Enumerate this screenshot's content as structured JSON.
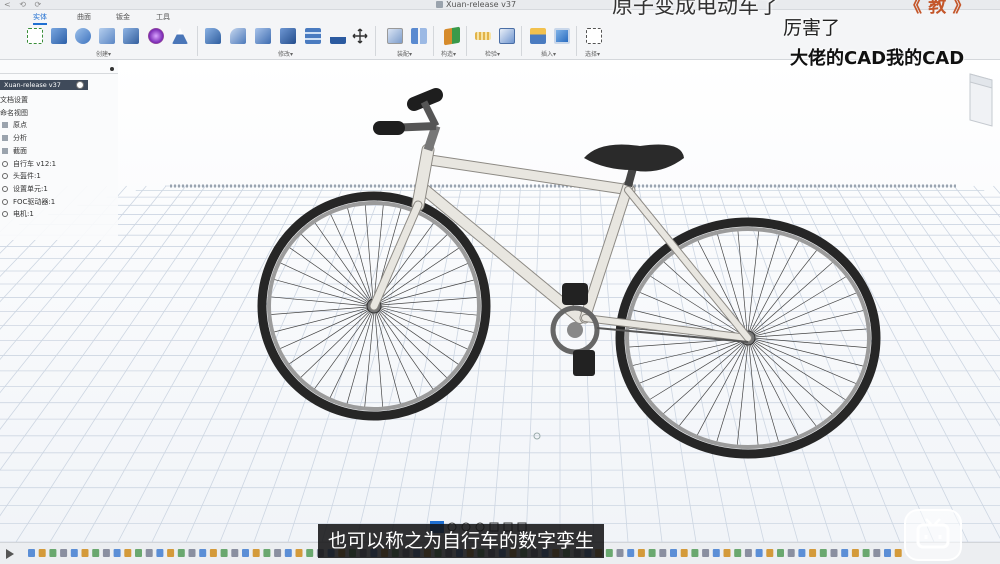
{
  "window": {
    "title": "Xuan-release v37",
    "quick_access": "< ⟲ ⟳"
  },
  "ribbon": {
    "tabs": [
      {
        "label": "实体",
        "active": true
      },
      {
        "label": "曲面",
        "active": false
      },
      {
        "label": "钣金",
        "active": false
      },
      {
        "label": "工具",
        "active": false
      }
    ],
    "groups": [
      "创建▾",
      "修改▾",
      "装配▾",
      "构造▾",
      "检验▾",
      "插入▾",
      "选择▾"
    ]
  },
  "browser": {
    "root": "Xuan-release v37",
    "items": [
      {
        "label": "文档设置",
        "icon": "none"
      },
      {
        "label": "命名视图",
        "icon": "none"
      },
      {
        "label": "原点",
        "icon": "folder-icon"
      },
      {
        "label": "分析",
        "icon": "folder-icon"
      },
      {
        "label": "截面",
        "icon": "folder-icon"
      },
      {
        "label": "自行车 v12:1",
        "icon": "component-icon"
      },
      {
        "label": "头盔件:1",
        "icon": "component-icon"
      },
      {
        "label": "设置单元:1",
        "icon": "component-icon"
      },
      {
        "label": "FOC驱动器:1",
        "icon": "component-icon"
      },
      {
        "label": "电机:1",
        "icon": "component-icon"
      }
    ]
  },
  "overlays": {
    "top_comment": "原子变成电动车了",
    "badge": "《 教 》",
    "mid_comment": "厉害了",
    "bottom_comment": "大佬的CAD我的CAD"
  },
  "subtitle": "也可以称之为自行车的数字孪生",
  "colors": {
    "accent": "#1f6fd1",
    "browser_header": "#3f4a5a",
    "grid": "#cdd6e2",
    "frame": "#e8e6e0",
    "tire": "#262626"
  }
}
